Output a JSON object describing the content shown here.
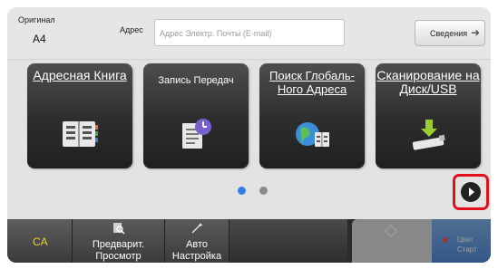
{
  "original": {
    "title": "Оригинал",
    "value": "A4"
  },
  "address": {
    "label": "Адрес",
    "placeholder": "Адрес Электр. Почты (E-mail)"
  },
  "info_button": {
    "label": "Сведения"
  },
  "tiles": [
    {
      "label": "Адресная Книга",
      "icon": "address-book-icon"
    },
    {
      "label": "Запись Передач",
      "icon": "transmission-log-icon"
    },
    {
      "label": "Поиск Глобаль-Ного Адреса",
      "icon": "global-search-icon"
    },
    {
      "label": "Сканирование на Диск/USB",
      "icon": "usb-scan-icon"
    }
  ],
  "pagination": {
    "pages": 2,
    "current": 1
  },
  "bottom_bar": {
    "ca_label": "CA",
    "preview_label": "Предварит. Просмотр",
    "auto_label": "Авто Настройка",
    "color_start_label": "Цвет Старт"
  },
  "colors": {
    "accent_blue": "#2f7fe0",
    "highlight_red": "#e0101c",
    "ca_yellow": "#f3d21a"
  }
}
